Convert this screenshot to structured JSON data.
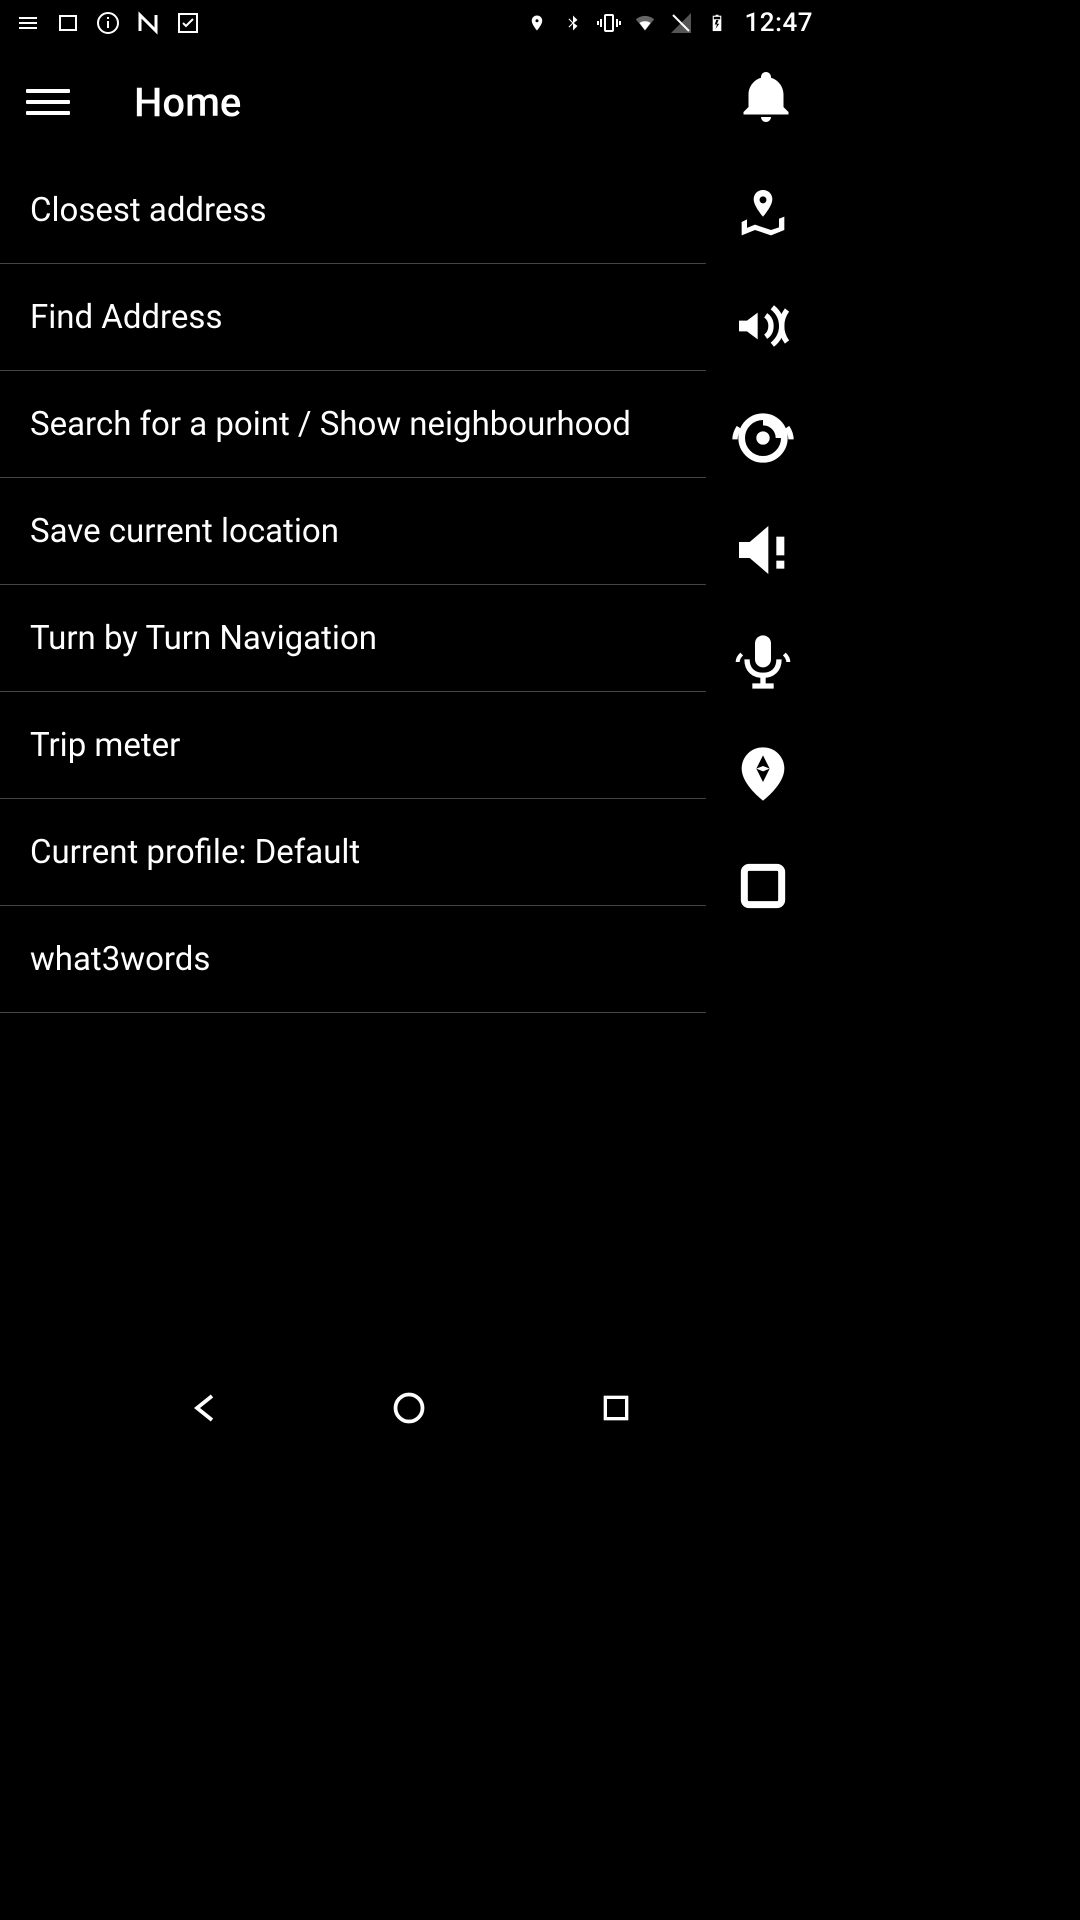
{
  "statusBar": {
    "time": "12:47"
  },
  "appBar": {
    "title": "Home"
  },
  "menuItems": [
    "Closest address",
    "Find Address",
    "Search for a point / Show neighbourhood",
    "Save current location",
    "Turn by Turn Navigation",
    "Trip meter",
    "Current profile: Default",
    "what3words"
  ]
}
